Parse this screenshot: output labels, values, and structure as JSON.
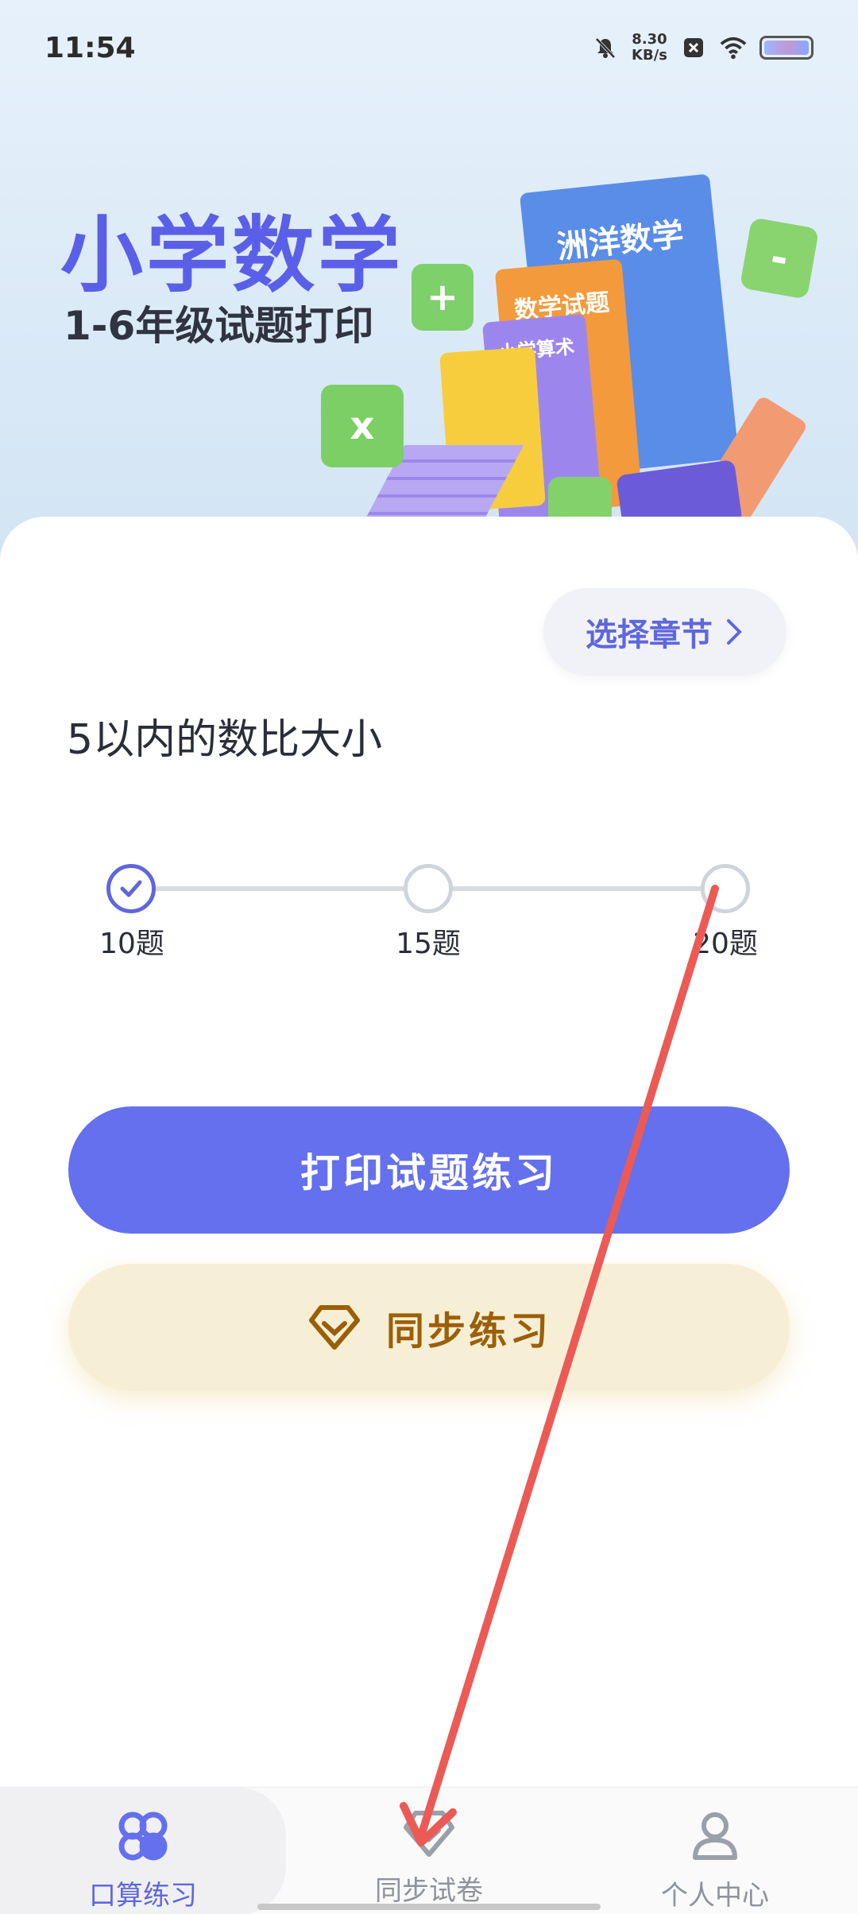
{
  "status_bar": {
    "time": "11:54",
    "net_speed_value": "8.30",
    "net_speed_unit": "KB/s"
  },
  "banner": {
    "title": "小学数学",
    "subtitle": "1-6年级试题打印",
    "book_labels": [
      "洲洋数学",
      "数学试题",
      "小学算术"
    ],
    "cube_symbols": [
      "+",
      "-",
      "x"
    ]
  },
  "chapter_button": {
    "label": "选择章节"
  },
  "topic": "5以内的数比大小",
  "question_count": {
    "options": [
      {
        "label": "10题",
        "selected": true
      },
      {
        "label": "15题",
        "selected": false
      },
      {
        "label": "20题",
        "selected": false
      }
    ]
  },
  "actions": {
    "print_label": "打印试题练习",
    "sync_label": "同步练习"
  },
  "bottom_nav": {
    "items": [
      {
        "label": "口算练习",
        "icon": "grid-flower-icon",
        "active": true
      },
      {
        "label": "同步试卷",
        "icon": "diamond-icon",
        "active": false
      },
      {
        "label": "个人中心",
        "icon": "person-icon",
        "active": false
      }
    ]
  },
  "colors": {
    "accent": "#6470ee",
    "sync_bg": "#f6efd6",
    "sync_text": "#9c5f07",
    "annotation_arrow": "#ec5a55"
  }
}
